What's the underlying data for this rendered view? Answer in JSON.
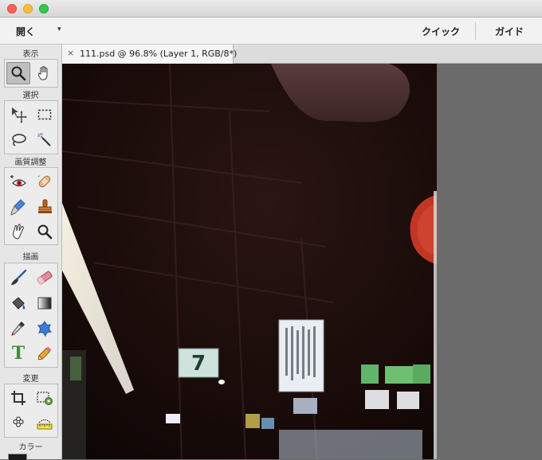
{
  "window": {
    "controls": [
      "close",
      "minimize",
      "zoom"
    ]
  },
  "menubar": {
    "open_label": "開く",
    "open_caret": "▾",
    "modes": {
      "quick": "クイック",
      "guide": "ガイド"
    }
  },
  "toolbox": {
    "sections": {
      "view": "表示",
      "select": "選択",
      "enhance": "画質調整",
      "draw": "描画",
      "modify": "変更",
      "color": "カラー"
    },
    "tools": {
      "zoom": "zoom-icon",
      "hand": "hand-icon",
      "move": "move-icon",
      "marquee": "marquee-icon",
      "lasso": "lasso-icon",
      "magic_wand": "magic-wand-icon",
      "red_eye": "red-eye-icon",
      "healing": "healing-brush-icon",
      "smart_brush": "smart-brush-icon",
      "clone_stamp": "clone-stamp-icon",
      "smudge": "smudge-icon",
      "sponge": "sponge-icon",
      "brush": "brush-icon",
      "eraser": "eraser-icon",
      "paint_bucket": "paint-bucket-icon",
      "gradient": "gradient-icon",
      "eyedropper": "eyedropper-icon",
      "custom_shape": "custom-shape-icon",
      "text": "text-icon",
      "pencil": "pencil-icon",
      "crop": "crop-icon",
      "recompose": "recompose-icon",
      "content_aware_move": "content-aware-move-icon",
      "straighten": "straighten-icon"
    },
    "active_tool": "zoom",
    "text_tool_glyph": "T"
  },
  "document": {
    "tab_close": "×",
    "tab_title": "111.psd @ 96.8% (Layer 1, RGB/8*)",
    "photo_sign_text": "7"
  },
  "colors": {
    "accent_text_tool": "#3f8f3a",
    "photo_background": "#1a0d0b",
    "workspace": "#6b6b6b"
  }
}
